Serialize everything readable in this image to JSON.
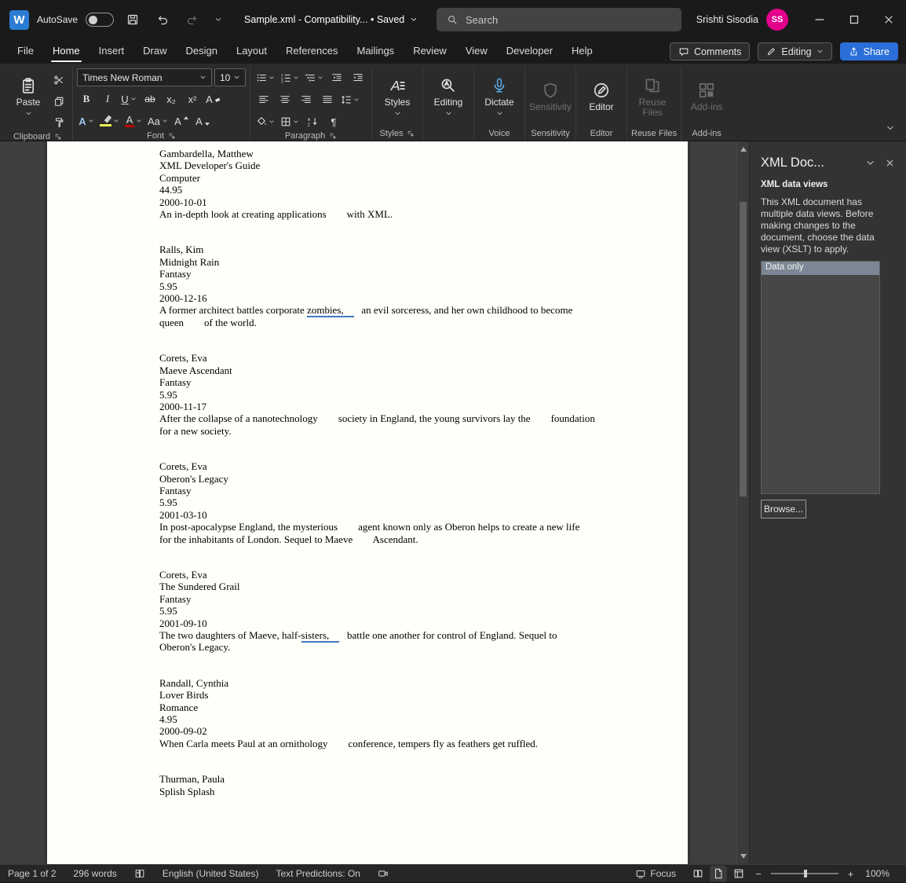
{
  "titlebar": {
    "word_logo": "W",
    "autosave_label": "AutoSave",
    "doc_title": "Sample.xml  -  Compatibility...   •  Saved",
    "search_placeholder": "Search",
    "user_name": "Srishti Sisodia",
    "user_initials": "SS"
  },
  "menubar": {
    "tabs": [
      "File",
      "Home",
      "Insert",
      "Draw",
      "Design",
      "Layout",
      "References",
      "Mailings",
      "Review",
      "View",
      "Developer",
      "Help"
    ],
    "active_tab": "Home",
    "comments_label": "Comments",
    "editing_label": "Editing",
    "share_label": "Share"
  },
  "ribbon": {
    "paste_label": "Paste",
    "font_name": "Times New Roman",
    "font_size": "10",
    "styles_label": "Styles",
    "editing_label": "Editing",
    "dictate_label": "Dictate",
    "sensitivity_label": "Sensitivity",
    "editor_label": "Editor",
    "reuse_files_label": "Reuse Files",
    "addins_label": "Add-ins",
    "glyphs": {
      "bold": "B",
      "italic": "I",
      "underline": "U",
      "strikethrough": "ab",
      "subscript": "x₂",
      "superscript": "x²",
      "clear_format": "A",
      "text_effects": "A",
      "font_color": "A",
      "change_case": "Aa",
      "grow_font": "A",
      "shrink_font": "A",
      "pilcrow": "¶"
    },
    "group_labels": {
      "clipboard": "Clipboard",
      "font": "Font",
      "paragraph": "Paragraph",
      "styles": "Styles",
      "voice": "Voice",
      "sensitivity": "Sensitivity",
      "editor": "Editor",
      "reuse_files": "Reuse Files",
      "addins": "Add-ins"
    }
  },
  "document": {
    "books": [
      {
        "author": "Gambardella, Matthew",
        "title": "XML Developer's Guide",
        "genre": "Computer",
        "price": "44.95",
        "date": "2000-10-01",
        "desc": [
          [
            {
              "t": "An in-depth look at creating applications        with XML."
            }
          ]
        ]
      },
      {
        "author": "Ralls, Kim",
        "title": "Midnight Rain",
        "genre": "Fantasy",
        "price": "5.95",
        "date": "2000-12-16",
        "desc": [
          [
            {
              "t": "A former architect battles corporate "
            },
            {
              "t": "zombies,    ",
              "u": true
            },
            {
              "t": "   an evil sorceress, and her own childhood to become"
            }
          ],
          [
            {
              "t": "queen        of the world."
            }
          ]
        ]
      },
      {
        "author": "Corets, Eva",
        "title": "Maeve Ascendant",
        "genre": "Fantasy",
        "price": "5.95",
        "date": "2000-11-17",
        "desc": [
          [
            {
              "t": "After the collapse of a nanotechnology        society in England, the young survivors lay the        foundation"
            }
          ],
          [
            {
              "t": "for a new society."
            }
          ]
        ]
      },
      {
        "author": "Corets, Eva",
        "title": "Oberon's Legacy",
        "genre": "Fantasy",
        "price": "5.95",
        "date": "2001-03-10",
        "desc": [
          [
            {
              "t": "In post-apocalypse England, the mysterious        agent known only as Oberon helps to create a new life"
            }
          ],
          [
            {
              "t": "for the inhabitants of London. Sequel to Maeve        Ascendant."
            }
          ]
        ]
      },
      {
        "author": "Corets, Eva",
        "title": "The Sundered Grail",
        "genre": "Fantasy",
        "price": "5.95",
        "date": "2001-09-10",
        "desc": [
          [
            {
              "t": "The two daughters of Maeve, half-"
            },
            {
              "t": "sisters,    ",
              "u": true
            },
            {
              "t": "   battle one another for control of England. Sequel to"
            }
          ],
          [
            {
              "t": "Oberon's Legacy."
            }
          ]
        ]
      },
      {
        "author": "Randall, Cynthia",
        "title": "Lover Birds",
        "genre": "Romance",
        "price": "4.95",
        "date": "2000-09-02",
        "desc": [
          [
            {
              "t": "When Carla meets Paul at an ornithology        conference, tempers fly as feathers get ruffled."
            }
          ]
        ]
      },
      {
        "author": "Thurman, Paula",
        "title": "Splish Splash",
        "genre": "",
        "price": "",
        "date": "",
        "desc": []
      }
    ]
  },
  "taskpane": {
    "title": "XML Doc...",
    "section_title": "XML data views",
    "description": "This XML document has multiple data views. Before making changes to the document, choose the data view (XSLT) to apply.",
    "list_selected": "Data only",
    "browse_label": "Browse..."
  },
  "statusbar": {
    "page": "Page 1 of 2",
    "words": "296 words",
    "language": "English (United States)",
    "predictions": "Text Predictions: On",
    "focus": "Focus",
    "zoom_out": "−",
    "zoom_in": "+",
    "zoom": "100%"
  },
  "colors": {
    "accent_blue": "#2b7cd3",
    "share_blue": "#2a6fd8",
    "avatar_pink": "#e3008c",
    "highlight_yellow": "#e8ef55",
    "font_color_red": "#c00000",
    "grammar_underline_blue": "#4377c4",
    "list_selection": "#7b8794"
  }
}
